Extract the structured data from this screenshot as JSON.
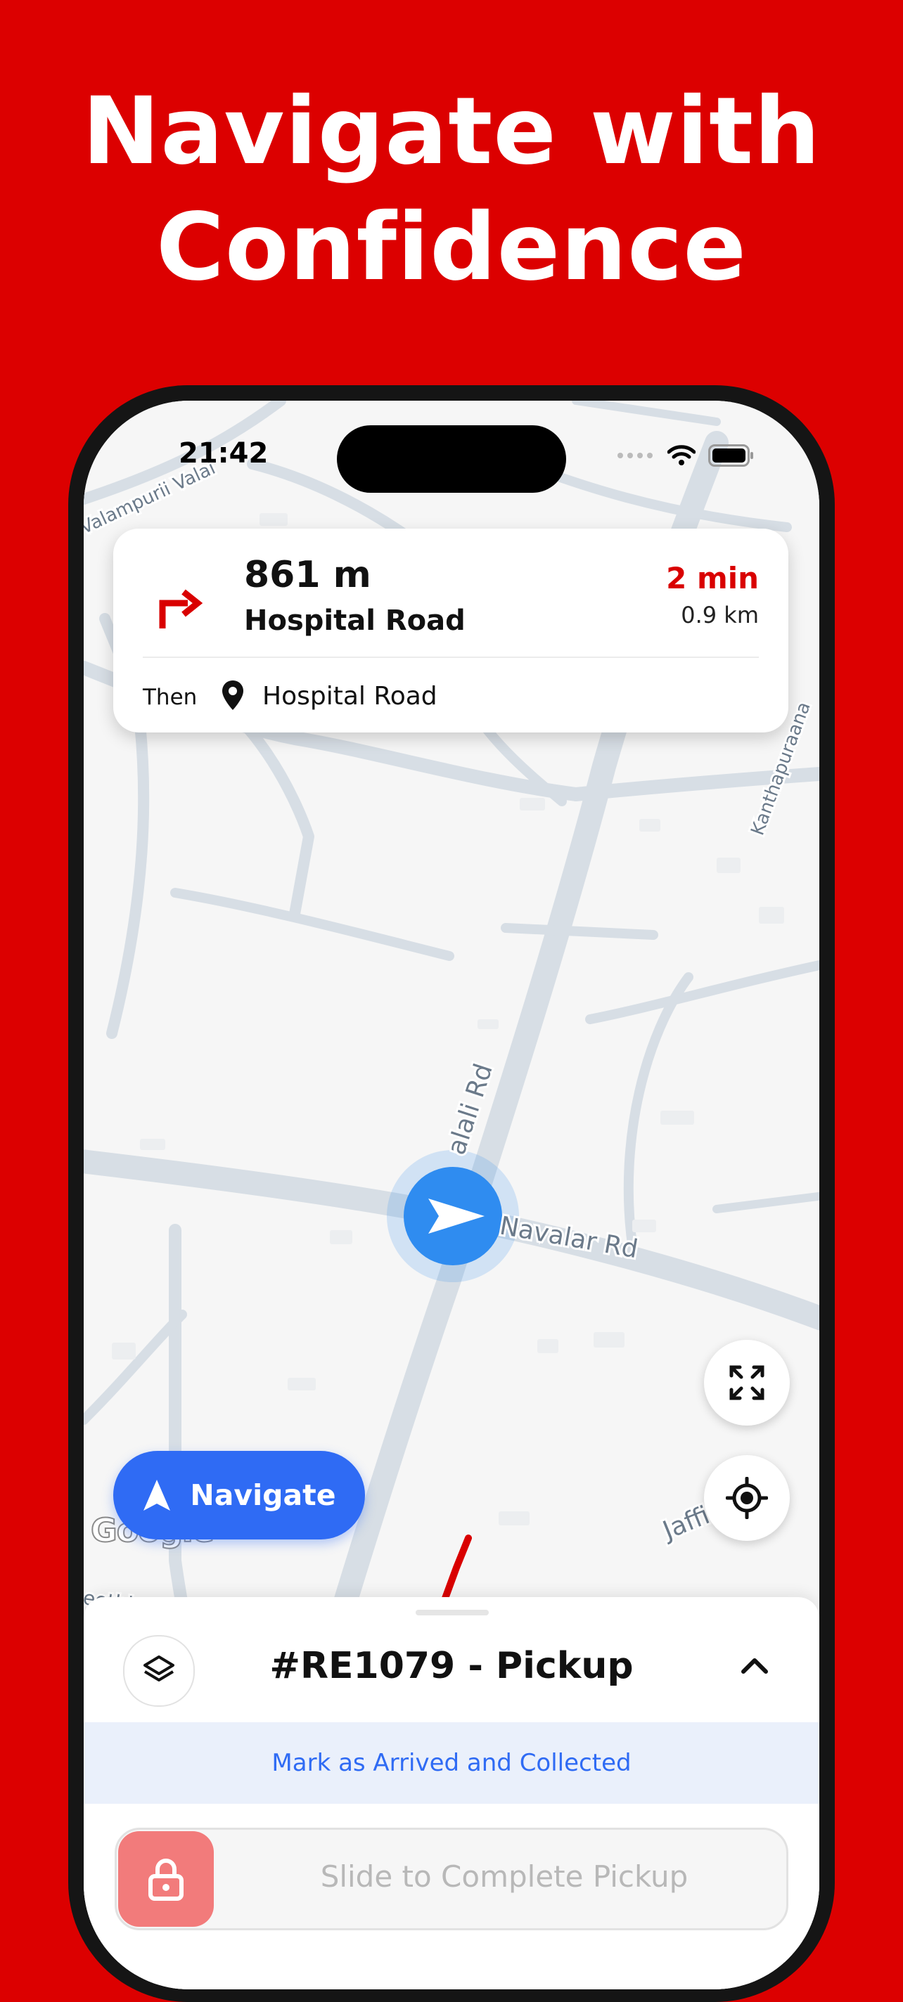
{
  "promo": {
    "headline_line1": "Navigate with",
    "headline_line2": "Confidence"
  },
  "status_bar": {
    "time": "21:42"
  },
  "map": {
    "labels": {
      "road_top_left": "Valampurii Valai",
      "road_vertical": "alali Rd",
      "road_navalar": "Navalar Rd",
      "road_right": "Kanthapuraana",
      "road_bottom": "Jaffi...ant",
      "road_bottom_left": "eethi"
    },
    "google_logo": "Google"
  },
  "navigation_card": {
    "distance": "861 m",
    "road": "Hospital Road",
    "eta_time": "2 min",
    "eta_distance": "0.9 km",
    "then_label": "Then",
    "then_road": "Hospital Road",
    "turn_icon": "turn-right-icon"
  },
  "navigate_button": {
    "label": "Navigate",
    "icon": "navigation-arrow-icon"
  },
  "bottom_sheet": {
    "order_title": "#RE1079 - Pickup",
    "arrived_action": "Mark as Arrived and Collected",
    "slider_label": "Slide to Complete Pickup"
  },
  "colors": {
    "brand_red": "#DC0000",
    "accent_blue": "#2F6BF4",
    "route_red": "#D90000",
    "slider_knob": "#F27B7B"
  }
}
